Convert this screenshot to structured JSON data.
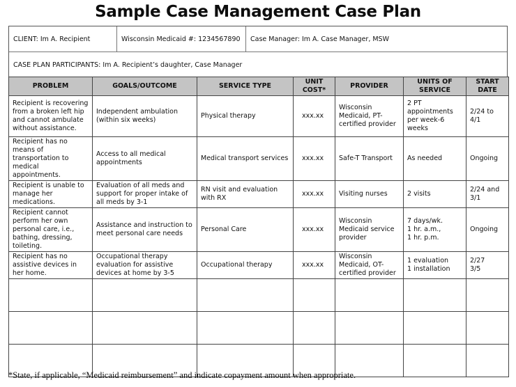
{
  "title": "Sample Case Management Case Plan",
  "info": {
    "client": "CLIENT: Im A. Recipient",
    "medicaid": "Wisconsin Medicaid #: 1234567890",
    "case_manager": "Case Manager: Im A. Case Manager, MSW",
    "participants": "CASE PLAN PARTICIPANTS: Im A. Recipient’s daughter, Case Manager"
  },
  "table": {
    "headers": [
      "PROBLEM",
      "GOALS/OUTCOME",
      "SERVICE TYPE",
      "UNIT COST*",
      "PROVIDER",
      "UNITS OF SERVICE",
      "START DATE"
    ],
    "header_lines": [
      [
        "PROBLEM"
      ],
      [
        "GOALS/OUTCOME"
      ],
      [
        "SERVICE TYPE"
      ],
      [
        "UNIT",
        "COST*"
      ],
      [
        "PROVIDER"
      ],
      [
        "UNITS OF",
        "SERVICE"
      ],
      [
        "START",
        "DATE"
      ]
    ],
    "rows": [
      [
        "Recipient is recovering from a broken left hip and cannot ambulate without assistance.",
        "Independent ambulation (within six weeks)",
        "Physical therapy",
        "xxx.xx",
        "Wisconsin Medicaid, PT-certified provider",
        "2 PT appointments per week-6 weeks",
        "2/24 to 4/1"
      ],
      [
        "Recipient has no means of transportation to medical appointments.",
        "Access to all medical appointments",
        "Medical transport services",
        "xxx.xx",
        "Safe-T Transport",
        "As needed",
        "Ongoing"
      ],
      [
        "Recipient is unable to manage her medications.",
        "Evaluation of all meds and support for proper intake of all meds by 3-1",
        "RN visit and evaluation with RX",
        "xxx.xx",
        "Visiting nurses",
        "2 visits",
        "2/24 and 3/1"
      ],
      [
        "Recipient cannot perform her own personal care, i.e., bathing, dressing, toileting.",
        "Assistance and instruction to meet personal care needs",
        "Personal Care",
        "xxx.xx",
        "Wisconsin Medicaid service provider",
        "7 days/wk. 1 hr. a.m., 1 hr. p.m.",
        "Ongoing"
      ],
      [
        "Recipient has no assistive devices in her home.",
        "Occupational therapy evaluation for assistive devices at home by 3-5",
        "Occupational therapy",
        "xxx.xx",
        "Wisconsin Medicaid, OT-certified provider",
        "1 evaluation 1 installation",
        "2/27 3/5"
      ]
    ],
    "units_r4_lines": [
      "7 days/wk.",
      "1 hr. a.m.,",
      "1 hr. p.m."
    ],
    "units_r5_lines": [
      "1 evaluation",
      "1 installation"
    ],
    "start_r5_lines": [
      "2/27",
      "3/5"
    ],
    "empty_rows": 3
  },
  "footnote": "*State, if applicable, “Medicaid reimbursement” and indicate copayment amount when appropriate."
}
